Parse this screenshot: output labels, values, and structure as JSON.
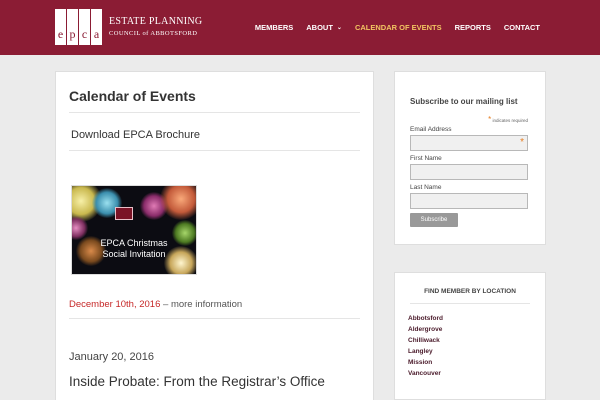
{
  "logo": {
    "letters": [
      "e",
      "p",
      "c",
      "a"
    ],
    "line1": "ESTATE PLANNING",
    "line2": "COUNCIL of ABBOTSFORD"
  },
  "nav": {
    "items": [
      {
        "label": "MEMBERS"
      },
      {
        "label": "ABOUT"
      },
      {
        "label": "CALENDAR OF EVENTS"
      },
      {
        "label": "REPORTS"
      },
      {
        "label": "CONTACT"
      }
    ],
    "about_caret": "⌄"
  },
  "main": {
    "title": "Calendar of Events",
    "brochure_link": "Download EPCA Brochure",
    "invite_image": {
      "line1": "EPCA Christmas",
      "line2": "Social Invitation"
    },
    "event": {
      "date": "December 10th, 2016",
      "separator": " – ",
      "more": "more information"
    },
    "post": {
      "date": "January 20, 2016",
      "title": "Inside Probate: From the Registrar’s Office"
    }
  },
  "mailing": {
    "title": "Subscribe to our mailing list",
    "required_star": "*",
    "required_note": " indicates required",
    "fields": [
      {
        "label": "Email Address",
        "required": "*"
      },
      {
        "label": "First Name"
      },
      {
        "label": "Last Name"
      }
    ],
    "subscribe_label": "Subscribe"
  },
  "locations": {
    "title": "FIND MEMBER BY LOCATION",
    "items": [
      "Abbotsford",
      "Aldergrove",
      "Chilliwack",
      "Langley",
      "Mission",
      "Vancouver"
    ]
  },
  "colors": {
    "brand": "#8b1c34",
    "nav_active": "#f2c462",
    "event_date": "#c62828"
  }
}
